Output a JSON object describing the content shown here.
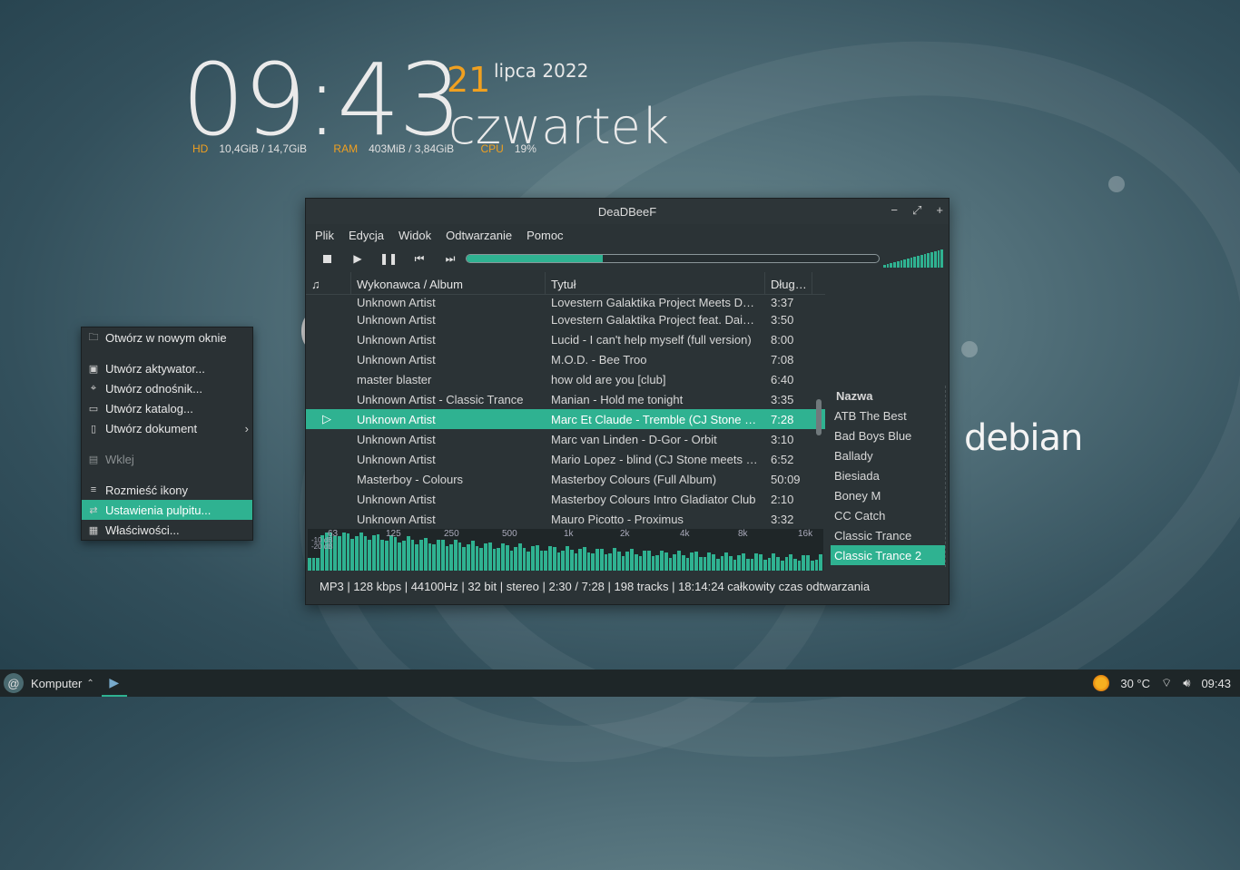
{
  "colors": {
    "accent": "#2fb291",
    "orange": "#f0a020"
  },
  "conky": {
    "time": "09:43",
    "day": "21",
    "month_year": "lipca 2022",
    "weekday": "czwartek",
    "hd_label": "HD",
    "hd_value": "10,4GiB / 14,7GiB",
    "ram_label": "RAM",
    "ram_value": "403MiB / 3,84GiB",
    "cpu_label": "CPU",
    "cpu_value": "19%"
  },
  "desktop": {
    "logo_text": "debian"
  },
  "window": {
    "title": "DeaDBeeF",
    "menu": [
      "Plik",
      "Edycja",
      "Widok",
      "Odtwarzanie",
      "Pomoc"
    ],
    "seek_fraction": 0.33,
    "volume_fraction": 1.0,
    "playlist": {
      "headers": {
        "icon": "♫",
        "artist": "Wykonawca / Album",
        "title": "Tytuł",
        "length": "Dług…"
      },
      "rows": [
        {
          "artist": "Unknown Artist",
          "title": "Lovestern Galaktika Project Meets D…",
          "length": "3:37"
        },
        {
          "artist": "Unknown Artist",
          "title": "Lovestern Galaktika Project feat.  Dai…",
          "length": "3:50"
        },
        {
          "artist": "Unknown Artist",
          "title": "Lucid - I can't help myself (full version)",
          "length": "8:00"
        },
        {
          "artist": "Unknown Artist",
          "title": "M.O.D. - Bee Troo",
          "length": "7:08"
        },
        {
          "artist": "master blaster",
          "title": "how old are you [club]",
          "length": "6:40"
        },
        {
          "artist": "Unknown Artist - Classic Trance",
          "title": "Manian - Hold me tonight",
          "length": "3:35"
        },
        {
          "artist": "Unknown Artist",
          "title": "Marc Et Claude - Tremble (CJ Stone …",
          "length": "7:28",
          "playing": true
        },
        {
          "artist": "Unknown Artist",
          "title": "Marc van Linden - D-Gor - Orbit",
          "length": "3:10"
        },
        {
          "artist": "Unknown Artist",
          "title": "Mario Lopez - blind (CJ Stone meets …",
          "length": "6:52"
        },
        {
          "artist": "Masterboy - Colours",
          "title": "Masterboy Colours (Full Album)",
          "length": "50:09"
        },
        {
          "artist": "Unknown Artist",
          "title": "Masterboy Colours Intro Gladiator Club",
          "length": "2:10"
        },
        {
          "artist": "Unknown Artist",
          "title": "Mauro Picotto - Proximus",
          "length": "3:32"
        }
      ]
    },
    "side_panel": {
      "header": "Nazwa",
      "items": [
        "ATB The Best",
        "Bad Boys Blue",
        "Ballady",
        "Biesiada",
        "Boney M",
        "CC Catch",
        "Classic Trance",
        "Classic Trance 2"
      ],
      "selected_index": 7
    },
    "spectrum": {
      "freq_labels": [
        "63",
        "125",
        "250",
        "500",
        "1k",
        "2k",
        "4k",
        "8k",
        "16k"
      ],
      "db_labels": [
        "-10 dB",
        "-20 dB"
      ]
    },
    "status": "MP3 | 128 kbps | 44100Hz | 32 bit | stereo | 2:30 / 7:28 | 198 tracks | 18:14:24 całkowity czas odtwarzania"
  },
  "context_menu": {
    "items": [
      {
        "label": "Otwórz w nowym oknie",
        "icon": "folder-icon"
      },
      {
        "sep": true
      },
      {
        "label": "Utwórz aktywator...",
        "icon": "launcher-icon"
      },
      {
        "label": "Utwórz odnośnik...",
        "icon": "link-icon"
      },
      {
        "label": "Utwórz katalog...",
        "icon": "new-folder-icon"
      },
      {
        "label": "Utwórz dokument",
        "icon": "new-document-icon",
        "submenu": true
      },
      {
        "sep": true
      },
      {
        "label": "Wklej",
        "icon": "paste-icon",
        "disabled": true
      },
      {
        "sep": true
      },
      {
        "label": "Rozmieść ikony",
        "icon": "arrange-icon"
      },
      {
        "label": "Ustawienia pulpitu...",
        "icon": "settings-icon",
        "highlighted": true
      },
      {
        "label": "Właściwości...",
        "icon": "properties-icon"
      }
    ]
  },
  "taskbar": {
    "menu_label": "Komputer",
    "temperature": "30 °C",
    "time": "09:43"
  }
}
